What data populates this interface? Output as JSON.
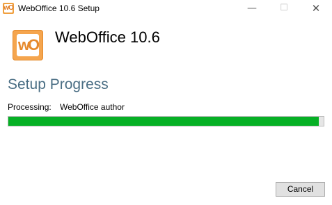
{
  "window": {
    "title": "WebOffice 10.6 Setup",
    "icon": "weboffice-logo-icon",
    "controls": {
      "minimize": "—",
      "maximize": "☐",
      "close": "✕"
    }
  },
  "header": {
    "app_name": "WebOffice 10.6",
    "logo_icon": "weboffice-logo-icon",
    "logo_text": "wO"
  },
  "main": {
    "section_title": "Setup Progress",
    "status_label": "Processing:",
    "status_value": "WebOffice author",
    "progress_fraction": 0.985,
    "progress_color": "#06b025"
  },
  "footer": {
    "cancel_label": "Cancel"
  }
}
